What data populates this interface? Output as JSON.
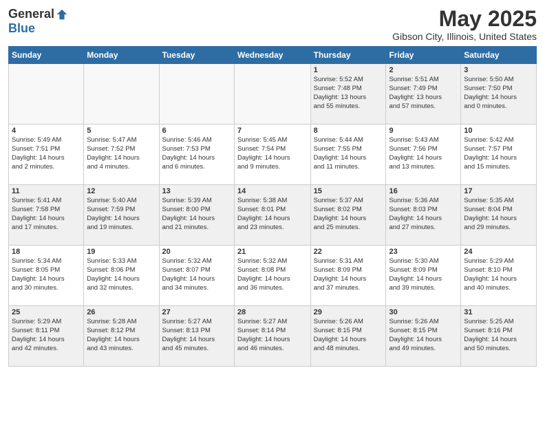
{
  "logo": {
    "general": "General",
    "blue": "Blue"
  },
  "title": "May 2025",
  "subtitle": "Gibson City, Illinois, United States",
  "days_of_week": [
    "Sunday",
    "Monday",
    "Tuesday",
    "Wednesday",
    "Thursday",
    "Friday",
    "Saturday"
  ],
  "weeks": [
    [
      {
        "day": "",
        "info": ""
      },
      {
        "day": "",
        "info": ""
      },
      {
        "day": "",
        "info": ""
      },
      {
        "day": "",
        "info": ""
      },
      {
        "day": "1",
        "info": "Sunrise: 5:52 AM\nSunset: 7:48 PM\nDaylight: 13 hours\nand 55 minutes."
      },
      {
        "day": "2",
        "info": "Sunrise: 5:51 AM\nSunset: 7:49 PM\nDaylight: 13 hours\nand 57 minutes."
      },
      {
        "day": "3",
        "info": "Sunrise: 5:50 AM\nSunset: 7:50 PM\nDaylight: 14 hours\nand 0 minutes."
      }
    ],
    [
      {
        "day": "4",
        "info": "Sunrise: 5:49 AM\nSunset: 7:51 PM\nDaylight: 14 hours\nand 2 minutes."
      },
      {
        "day": "5",
        "info": "Sunrise: 5:47 AM\nSunset: 7:52 PM\nDaylight: 14 hours\nand 4 minutes."
      },
      {
        "day": "6",
        "info": "Sunrise: 5:46 AM\nSunset: 7:53 PM\nDaylight: 14 hours\nand 6 minutes."
      },
      {
        "day": "7",
        "info": "Sunrise: 5:45 AM\nSunset: 7:54 PM\nDaylight: 14 hours\nand 9 minutes."
      },
      {
        "day": "8",
        "info": "Sunrise: 5:44 AM\nSunset: 7:55 PM\nDaylight: 14 hours\nand 11 minutes."
      },
      {
        "day": "9",
        "info": "Sunrise: 5:43 AM\nSunset: 7:56 PM\nDaylight: 14 hours\nand 13 minutes."
      },
      {
        "day": "10",
        "info": "Sunrise: 5:42 AM\nSunset: 7:57 PM\nDaylight: 14 hours\nand 15 minutes."
      }
    ],
    [
      {
        "day": "11",
        "info": "Sunrise: 5:41 AM\nSunset: 7:58 PM\nDaylight: 14 hours\nand 17 minutes."
      },
      {
        "day": "12",
        "info": "Sunrise: 5:40 AM\nSunset: 7:59 PM\nDaylight: 14 hours\nand 19 minutes."
      },
      {
        "day": "13",
        "info": "Sunrise: 5:39 AM\nSunset: 8:00 PM\nDaylight: 14 hours\nand 21 minutes."
      },
      {
        "day": "14",
        "info": "Sunrise: 5:38 AM\nSunset: 8:01 PM\nDaylight: 14 hours\nand 23 minutes."
      },
      {
        "day": "15",
        "info": "Sunrise: 5:37 AM\nSunset: 8:02 PM\nDaylight: 14 hours\nand 25 minutes."
      },
      {
        "day": "16",
        "info": "Sunrise: 5:36 AM\nSunset: 8:03 PM\nDaylight: 14 hours\nand 27 minutes."
      },
      {
        "day": "17",
        "info": "Sunrise: 5:35 AM\nSunset: 8:04 PM\nDaylight: 14 hours\nand 29 minutes."
      }
    ],
    [
      {
        "day": "18",
        "info": "Sunrise: 5:34 AM\nSunset: 8:05 PM\nDaylight: 14 hours\nand 30 minutes."
      },
      {
        "day": "19",
        "info": "Sunrise: 5:33 AM\nSunset: 8:06 PM\nDaylight: 14 hours\nand 32 minutes."
      },
      {
        "day": "20",
        "info": "Sunrise: 5:32 AM\nSunset: 8:07 PM\nDaylight: 14 hours\nand 34 minutes."
      },
      {
        "day": "21",
        "info": "Sunrise: 5:32 AM\nSunset: 8:08 PM\nDaylight: 14 hours\nand 36 minutes."
      },
      {
        "day": "22",
        "info": "Sunrise: 5:31 AM\nSunset: 8:09 PM\nDaylight: 14 hours\nand 37 minutes."
      },
      {
        "day": "23",
        "info": "Sunrise: 5:30 AM\nSunset: 8:09 PM\nDaylight: 14 hours\nand 39 minutes."
      },
      {
        "day": "24",
        "info": "Sunrise: 5:29 AM\nSunset: 8:10 PM\nDaylight: 14 hours\nand 40 minutes."
      }
    ],
    [
      {
        "day": "25",
        "info": "Sunrise: 5:29 AM\nSunset: 8:11 PM\nDaylight: 14 hours\nand 42 minutes."
      },
      {
        "day": "26",
        "info": "Sunrise: 5:28 AM\nSunset: 8:12 PM\nDaylight: 14 hours\nand 43 minutes."
      },
      {
        "day": "27",
        "info": "Sunrise: 5:27 AM\nSunset: 8:13 PM\nDaylight: 14 hours\nand 45 minutes."
      },
      {
        "day": "28",
        "info": "Sunrise: 5:27 AM\nSunset: 8:14 PM\nDaylight: 14 hours\nand 46 minutes."
      },
      {
        "day": "29",
        "info": "Sunrise: 5:26 AM\nSunset: 8:15 PM\nDaylight: 14 hours\nand 48 minutes."
      },
      {
        "day": "30",
        "info": "Sunrise: 5:26 AM\nSunset: 8:15 PM\nDaylight: 14 hours\nand 49 minutes."
      },
      {
        "day": "31",
        "info": "Sunrise: 5:25 AM\nSunset: 8:16 PM\nDaylight: 14 hours\nand 50 minutes."
      }
    ]
  ]
}
